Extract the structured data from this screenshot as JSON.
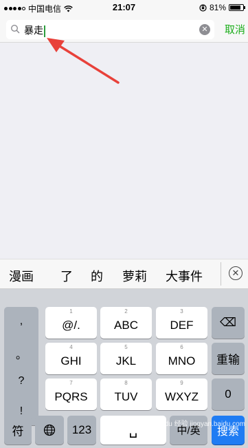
{
  "status": {
    "carrier": "中国电信",
    "time": "21:07",
    "battery": "81%",
    "battery_level": 0.81
  },
  "search": {
    "query": "暴走",
    "cancel_label": "取消",
    "clear_symbol": "✕"
  },
  "candidates": [
    "漫画",
    "了",
    "的",
    "萝莉",
    "大事件"
  ],
  "candidates_close": "✕",
  "keyboard": {
    "punct": [
      ",",
      "。",
      "?",
      "!"
    ],
    "keys": [
      {
        "num": "1",
        "label": "@/."
      },
      {
        "num": "2",
        "label": "ABC"
      },
      {
        "num": "3",
        "label": "DEF"
      },
      {
        "num": "4",
        "label": "GHI"
      },
      {
        "num": "5",
        "label": "JKL"
      },
      {
        "num": "6",
        "label": "MNO"
      },
      {
        "num": "7",
        "label": "PQRS"
      },
      {
        "num": "8",
        "label": "TUV"
      },
      {
        "num": "9",
        "label": "WXYZ"
      }
    ],
    "delete_symbol": "⌫",
    "reenter_label": "重输",
    "zero_label": "0",
    "symbol_label": "符",
    "number_label": "123",
    "space_label": "␣",
    "lang_label": "中/英",
    "search_label": "搜索"
  },
  "watermark": "Baidu 经验 jingyan.baidu.com",
  "colors": {
    "accent_green": "#1aad19",
    "search_key": "#1f7cf3",
    "arrow": "#e8413a"
  }
}
